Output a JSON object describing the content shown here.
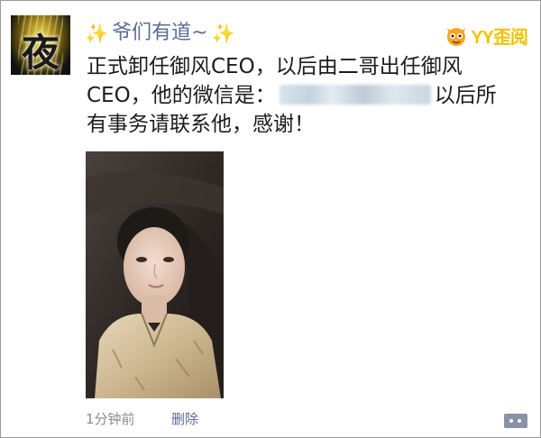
{
  "post": {
    "author": "爷们有道~",
    "sparkle_left": "✨",
    "sparkle_right": "✨",
    "avatar_glyph": "夜",
    "text_part1": "正式卸任御风CEO，以后由二哥出任御风CEO，他的微信是：",
    "text_part2": "以后所有事务请联系他，感谢！",
    "timestamp": "1分钟前",
    "delete_label": "删除"
  },
  "watermark": {
    "brand": "YY歪阅",
    "colors": {
      "yellow": "#f2c200",
      "mascot_face": "#f5a623"
    }
  },
  "colors": {
    "author_name": "#5b6b94",
    "body_text": "#1c1c1c",
    "meta_text": "#8c8c8c",
    "comment_button": "#8a93a6"
  }
}
